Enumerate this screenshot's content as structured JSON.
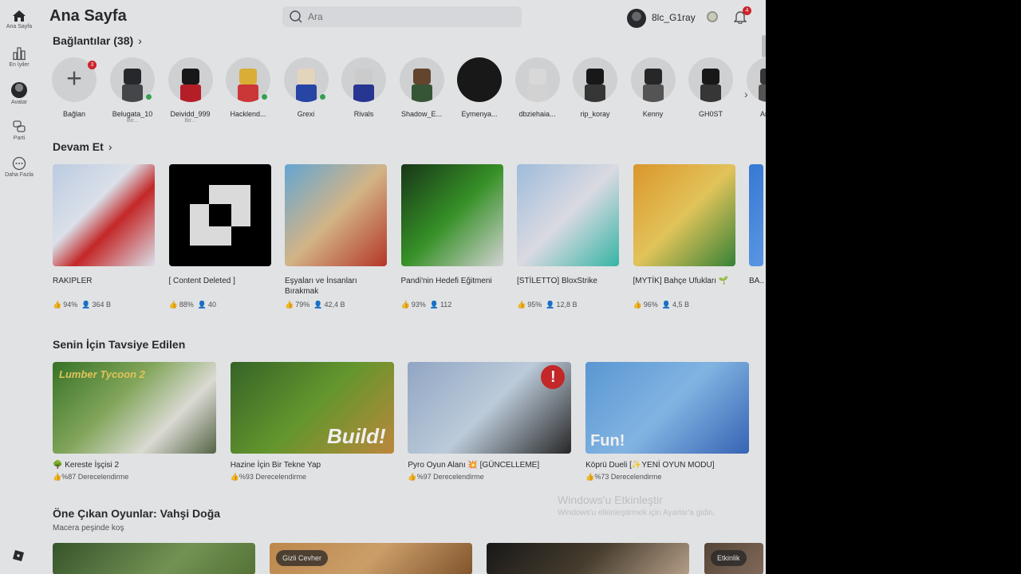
{
  "sidebar": {
    "items": [
      {
        "label": "Ana Sayfa",
        "icon": "home-icon"
      },
      {
        "label": "En İyiler",
        "icon": "charts-icon"
      },
      {
        "label": "Avatar",
        "icon": "avatar-icon"
      },
      {
        "label": "Parti",
        "icon": "party-icon"
      },
      {
        "label": "Daha Fazla",
        "icon": "more-icon"
      }
    ]
  },
  "header": {
    "title": "Ana Sayfa",
    "search_placeholder": "Ara",
    "username": "8lc_G1ray",
    "notification_count": "4"
  },
  "connections": {
    "title": "Bağlantılar (38)",
    "add_label": "Bağlan",
    "add_badge": "3",
    "friends": [
      {
        "name": "Belugata_10",
        "status": "Bir...",
        "online": true
      },
      {
        "name": "Deividd_999",
        "status": "Bir...",
        "online": false
      },
      {
        "name": "Hacklend...",
        "status": "",
        "online": true
      },
      {
        "name": "Grexi",
        "status": "",
        "online": true
      },
      {
        "name": "Rivals",
        "status": "",
        "online": false
      },
      {
        "name": "Shadow_E...",
        "status": "",
        "online": false
      },
      {
        "name": "Eymenya...",
        "status": "",
        "online": false
      },
      {
        "name": "dbziehaia...",
        "status": "",
        "online": false
      },
      {
        "name": "rip_koray",
        "status": "",
        "online": false
      },
      {
        "name": "Kenny",
        "status": "",
        "online": false
      },
      {
        "name": "GH0ST",
        "status": "",
        "online": false
      },
      {
        "name": "Am...",
        "status": "",
        "online": false
      }
    ]
  },
  "continue": {
    "title": "Devam Et",
    "games": [
      {
        "name": "RAKIPLER",
        "rating": "94%",
        "players": "364 B"
      },
      {
        "name": "[ Content Deleted ]",
        "rating": "88%",
        "players": "40"
      },
      {
        "name": "Eşyaları ve İnsanları Bırakmak",
        "rating": "79%",
        "players": "42,4 B"
      },
      {
        "name": "Pandi'nin Hedefi Eğitmeni",
        "rating": "93%",
        "players": "112"
      },
      {
        "name": "[STİLETTO] BloxStrike",
        "rating": "95%",
        "players": "12,8 B"
      },
      {
        "name": "[MYTİK] Bahçe Ufukları 🌱",
        "rating": "96%",
        "players": "4,5 B"
      },
      {
        "name": "BA...",
        "rating": "",
        "players": ""
      }
    ]
  },
  "recommended": {
    "title": "Senin İçin Tavsiye Edilen",
    "games": [
      {
        "name": "🌳 Kereste İşçisi 2",
        "rating": "%87 Derecelendirme",
        "thumb_text": "Lumber Tycoon 2"
      },
      {
        "name": "Hazine İçin Bir Tekne Yap",
        "rating": "%93 Derecelendirme",
        "thumb_text": "Build!"
      },
      {
        "name": "Pyro Oyun Alanı 💥 [GÜNCELLEME]",
        "rating": "%97 Derecelendirme",
        "thumb_text": "!"
      },
      {
        "name": "Köprü Dueli [✨YENİ OYUN MODU]",
        "rating": "%73 Derecelendirme",
        "thumb_text": "Fun!"
      }
    ]
  },
  "featured": {
    "title": "Öne Çıkan Oyunlar: Vahşi Doğa",
    "subtitle": "Macera peşinde koş",
    "tags": [
      "Gizli Cevher",
      "Etkinlik"
    ]
  },
  "watermark": {
    "line1": "Windows'u Etkinleştir",
    "line2": "Windows'u etkinleştirmek için Ayarlar'a gidin."
  },
  "colors": {
    "background": "#f0f1f3",
    "online": "#3aaa5a",
    "badge": "#d8262e"
  }
}
